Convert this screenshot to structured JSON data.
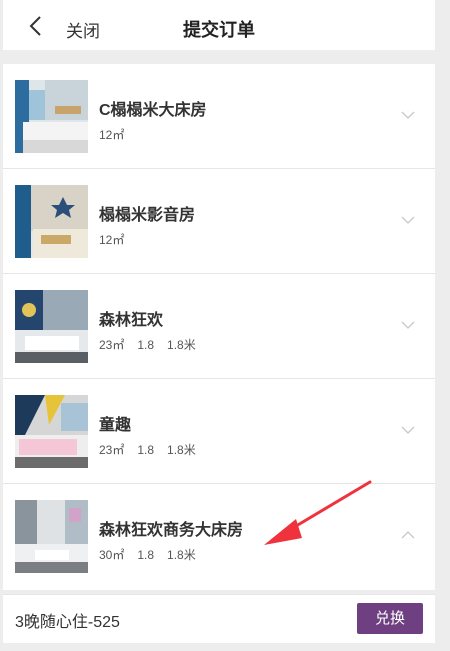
{
  "header": {
    "close_label": "关闭",
    "title": "提交订单"
  },
  "rooms": [
    {
      "name": "C榻榻米大床房",
      "area": "12㎡",
      "bed1": "",
      "bed2": "",
      "expanded": false
    },
    {
      "name": "榻榻米影音房",
      "area": "12㎡",
      "bed1": "",
      "bed2": "",
      "expanded": false
    },
    {
      "name": "森林狂欢",
      "area": "23㎡",
      "bed1": "1.8",
      "bed2": "1.8米",
      "expanded": false
    },
    {
      "name": "童趣",
      "area": "23㎡",
      "bed1": "1.8",
      "bed2": "1.8米",
      "expanded": false
    },
    {
      "name": "森林狂欢商务大床房",
      "area": "30㎡",
      "bed1": "1.8",
      "bed2": "1.8米",
      "expanded": true
    }
  ],
  "footer": {
    "package_label": "3晚随心住-525",
    "redeem_label": "兑换"
  },
  "colors": {
    "accent": "#6e3f81",
    "annotation_arrow": "#f0323c",
    "background": "#ededed"
  }
}
